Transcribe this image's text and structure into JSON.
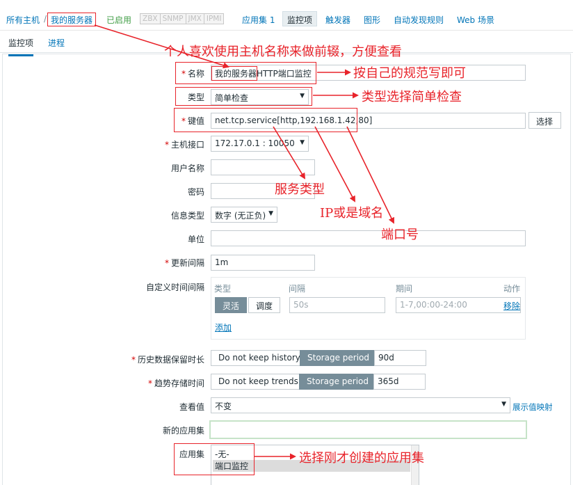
{
  "breadcrumb": {
    "all_hosts": "所有主机",
    "separator": "/",
    "host": "我的服务器",
    "status": "已启用",
    "availability": [
      "ZBX",
      "SNMP",
      "JMX",
      "IPMI"
    ]
  },
  "host_nav": {
    "applications": "应用集 1",
    "items": "监控项",
    "triggers": "触发器",
    "graphs": "图形",
    "discovery": "自动发现规则",
    "web": "Web 场景"
  },
  "tabs": [
    "监控项",
    "进程"
  ],
  "form": {
    "name_label": "名称",
    "name_value": "我的服务器HTTP端口监控",
    "type_label": "类型",
    "type_value": "简单检查",
    "key_label": "键值",
    "key_value": "net.tcp.service[http,192.168.1.42,80]",
    "select_button": "选择",
    "interface_label": "主机接口",
    "interface_value": "172.17.0.1 : 10050",
    "username_label": "用户名称",
    "password_label": "密码",
    "info_type_label": "信息类型",
    "info_type_value": "数字 (无正负)",
    "units_label": "单位",
    "interval_label": "更新间隔",
    "interval_value": "1m",
    "custom_intervals_label": "自定义时间间隔",
    "ci_col_type": "类型",
    "ci_col_interval": "间隔",
    "ci_col_period": "期间",
    "ci_col_action": "动作",
    "ci_flexible": "灵活",
    "ci_scheduling": "调度",
    "ci_interval_placeholder": "50s",
    "ci_period_placeholder": "1-7,00:00-24:00",
    "ci_remove": "移除",
    "ci_add": "添加",
    "history_label": "历史数据保留时长",
    "history_no_keep": "Do not keep history",
    "history_storage": "Storage period",
    "history_value": "90d",
    "trends_label": "趋势存储时间",
    "trends_no_keep": "Do not keep trends",
    "trends_storage": "Storage period",
    "trends_value": "365d",
    "show_value_label": "查看值",
    "show_value_value": "不变",
    "value_mapping_link": "展示值映射",
    "new_app_label": "新的应用集",
    "apps_label": "应用集",
    "apps_options": [
      "-无-",
      "端口监控"
    ]
  },
  "annotations": {
    "prefix_note": "个人喜欢使用主机名称来做前辍，方便查看",
    "name_note": "按自己的规范写即可",
    "type_note": "类型选择简单检查",
    "service_note": "服务类型",
    "ip_note": "IP或是域名",
    "port_note": "端口号",
    "apps_note": "选择刚才创建的应用集"
  },
  "colors": {
    "accent": "#0275b8",
    "annotation": "#e8232a",
    "enabled": "#429e47",
    "segment_active": "#768d99"
  }
}
